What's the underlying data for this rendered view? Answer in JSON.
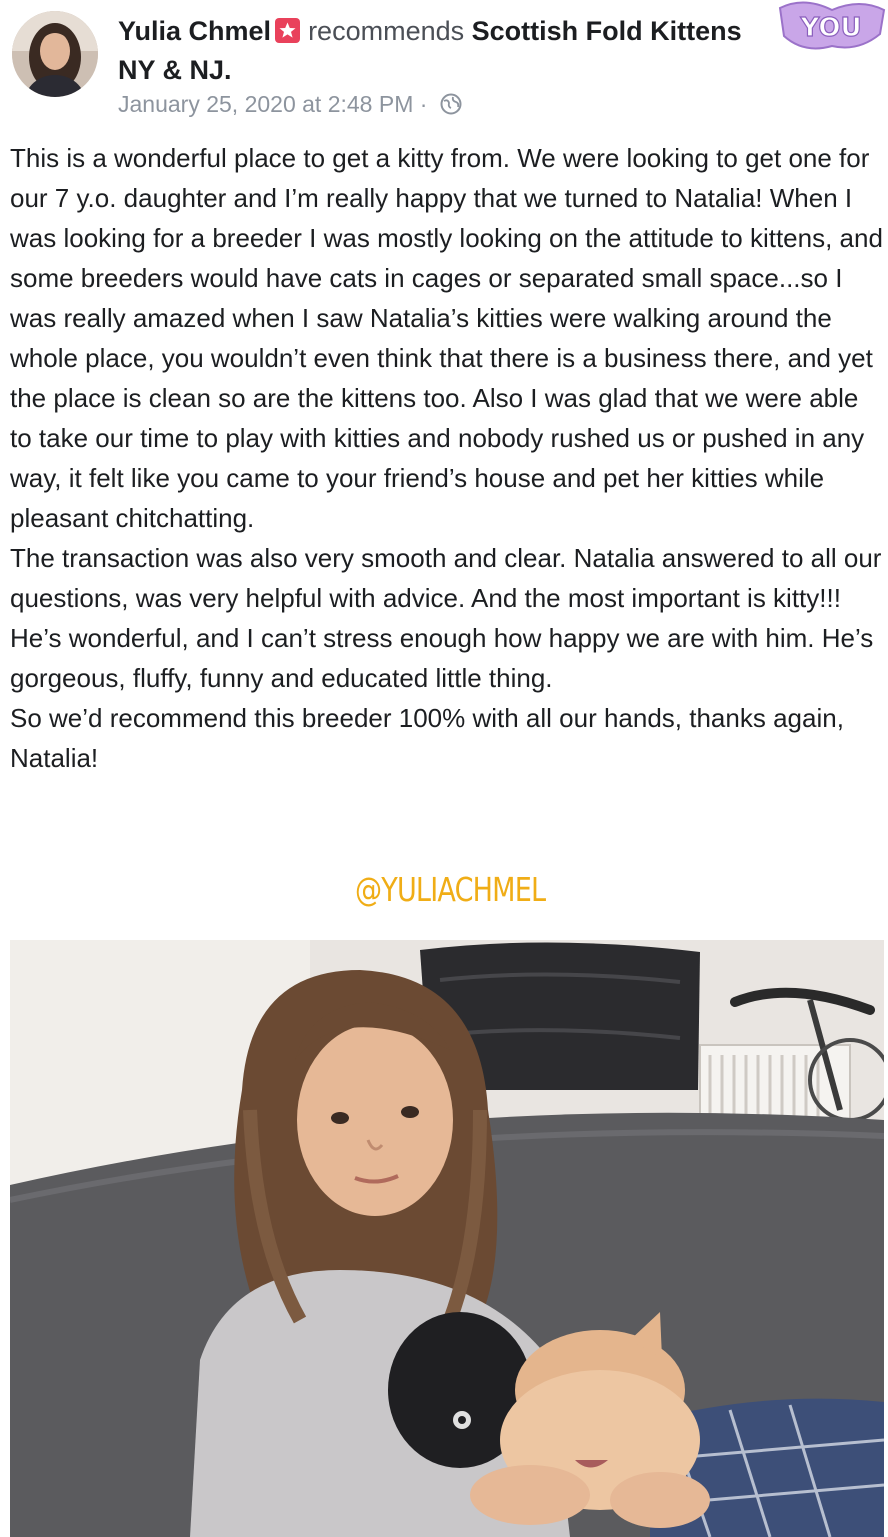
{
  "post": {
    "author": "Yulia Chmel",
    "verb": "recommends",
    "page": "Scottish Fold Kittens NY & NJ.",
    "timestamp": "January 25, 2020 at 2:48 PM",
    "separator": "·",
    "privacy_icon": "globe-icon",
    "recommend_icon": "recommend-star-icon",
    "body_paragraphs": [
      "This is a wonderful place to get a kitty from. We were looking to get one for our 7 y.o. daughter and I’m really happy that we turned to Natalia! When I was looking for a breeder I was mostly looking on the attitude to kittens, and some breeders would have cats in cages or separated small space...so I was really amazed when I saw Natalia’s kitties were walking around the whole place, you wouldn’t even think that there is a business there, and yet the place is clean so are the kittens too. Also I was glad that we were able to take our time to play with kitties and nobody rushed us or pushed in any way, it felt like you came to your friend’s house and pet her kitties while pleasant chitchatting.",
      "The transaction was also very smooth and clear. Natalia answered to all our questions, was very helpful with advice. And the most important is kitty!!! He’s wonderful, and I can’t stress enough how happy we are with him. He’s gorgeous, fluffy, funny and educated little thing.",
      "So we’d recommend this breeder 100% with all our hands, thanks again, Natalia!"
    ]
  },
  "overlay": {
    "handle": "@YULIACHMEL",
    "handle_color": "#f0ad16",
    "sticker": "YOU"
  },
  "colors": {
    "recommend_badge": "#e9415b",
    "timestamp": "#8d949e",
    "text": "#1c1e21"
  }
}
